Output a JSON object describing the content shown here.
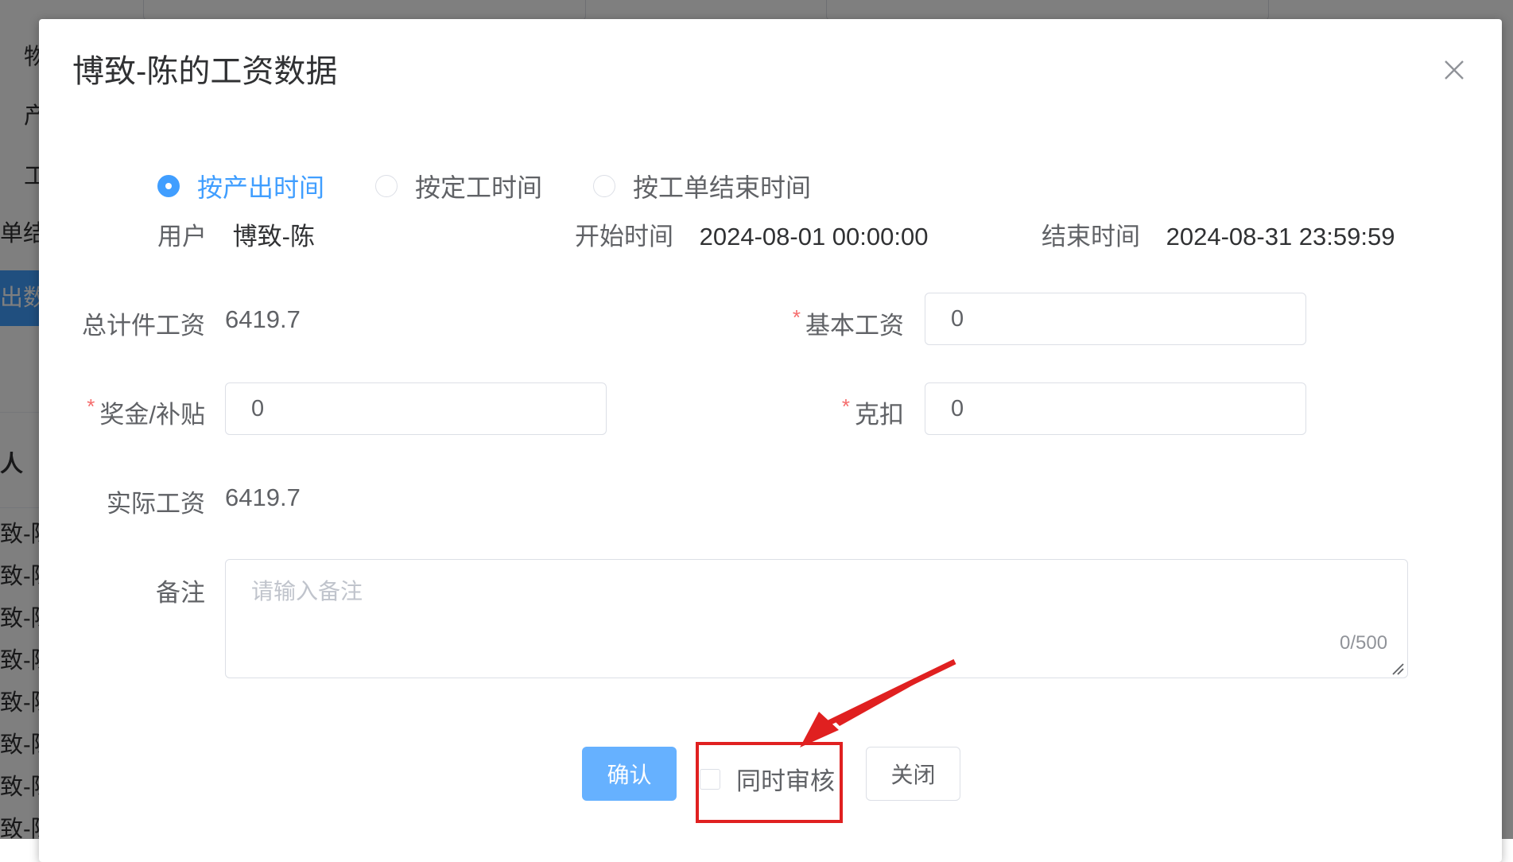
{
  "background": {
    "side_fragments": [
      "物",
      "产",
      "工",
      "单结"
    ],
    "export_button": "出数",
    "person_header": "人",
    "rows": [
      "致-陈",
      "致-陈",
      "致-陈",
      "致-陈",
      "致-陈",
      "致-陈",
      "致-陈",
      "致-陈"
    ]
  },
  "dialog": {
    "title": "博致-陈的工资数据",
    "close_icon": "close-icon",
    "radios": [
      {
        "label": "按产出时间",
        "checked": true
      },
      {
        "label": "按定工时间",
        "checked": false
      },
      {
        "label": "按工单结束时间",
        "checked": false
      }
    ],
    "info": {
      "user_label": "用户",
      "user_value": "博致-陈",
      "start_label": "开始时间",
      "start_value": "2024-08-01 00:00:00",
      "end_label": "结束时间",
      "end_value": "2024-08-31 23:59:59"
    },
    "form": {
      "total_piece_label": "总计件工资",
      "total_piece_value": "6419.7",
      "base_salary_label": "基本工资",
      "base_salary_value": "0",
      "bonus_label": "奖金/补贴",
      "bonus_value": "0",
      "deduction_label": "克扣",
      "deduction_value": "0",
      "actual_label": "实际工资",
      "actual_value": "6419.7",
      "remark_label": "备注",
      "remark_placeholder": "请输入备注",
      "remark_count": "0/500"
    },
    "footer": {
      "confirm_label": "确认",
      "audit_label": "同时审核",
      "close_label": "关闭"
    }
  },
  "colors": {
    "primary": "#409eff",
    "primary_light": "#66b1ff",
    "required": "#f56c6c",
    "annotation": "#e02020"
  }
}
